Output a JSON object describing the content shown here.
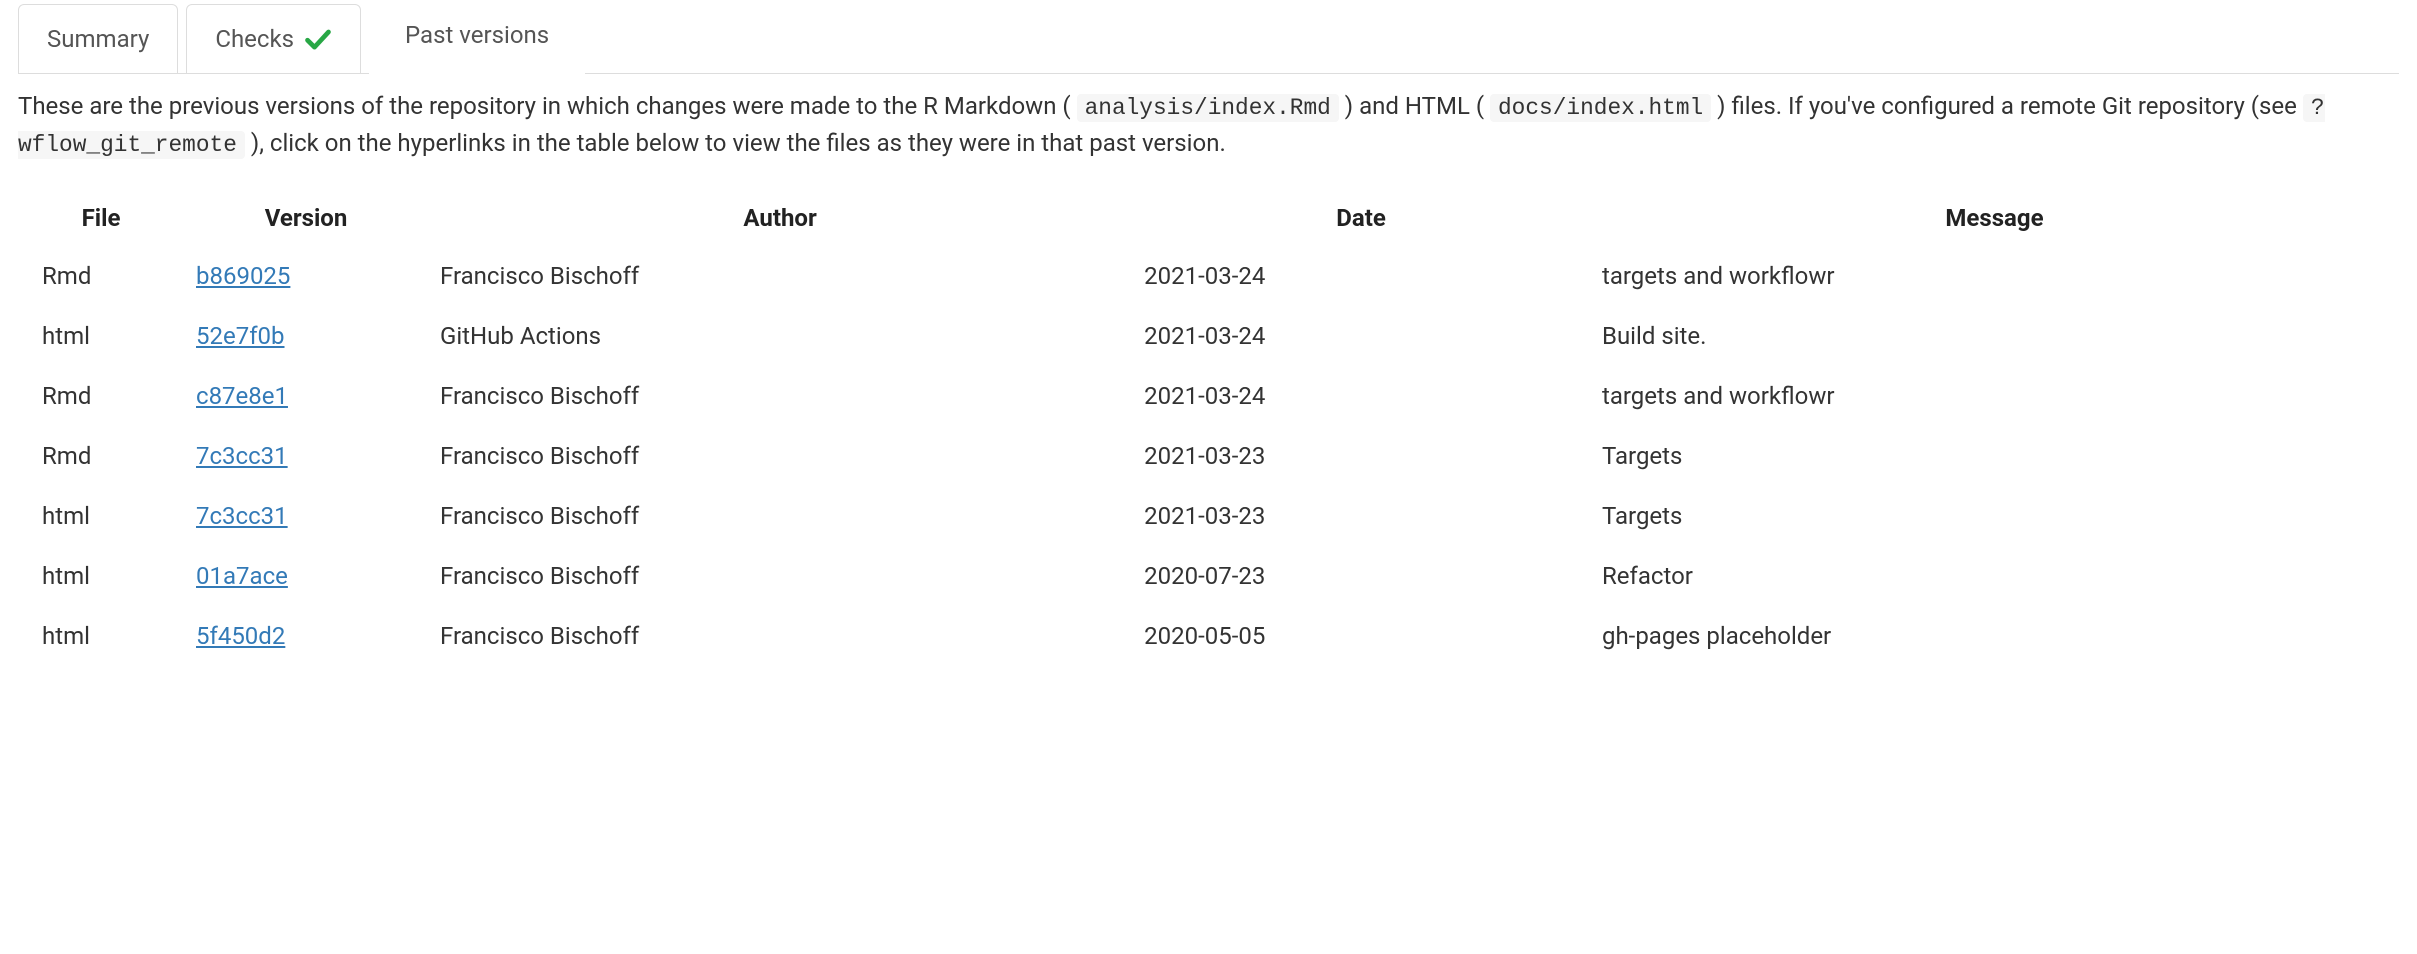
{
  "tabs": {
    "summary": {
      "label": "Summary"
    },
    "checks": {
      "label": "Checks"
    },
    "past_versions": {
      "label": "Past versions"
    }
  },
  "intro": {
    "part1": "These are the previous versions of the repository in which changes were made to the R Markdown (",
    "code1": "analysis/index.Rmd",
    "part2": ") and HTML (",
    "code2": "docs/index.html",
    "part3": ") files. If you've configured a remote Git repository (see ",
    "code3": "?wflow_git_remote",
    "part4": "), click on the hyperlinks in the table below to view the files as they were in that past version."
  },
  "table": {
    "headers": {
      "file": "File",
      "version": "Version",
      "author": "Author",
      "date": "Date",
      "message": "Message"
    },
    "rows": [
      {
        "file": "Rmd",
        "version": "b869025",
        "author": "Francisco Bischoff",
        "date": "2021-03-24",
        "message": "targets and workflowr"
      },
      {
        "file": "html",
        "version": "52e7f0b",
        "author": "GitHub Actions",
        "date": "2021-03-24",
        "message": "Build site."
      },
      {
        "file": "Rmd",
        "version": "c87e8e1",
        "author": "Francisco Bischoff",
        "date": "2021-03-24",
        "message": "targets and workflowr"
      },
      {
        "file": "Rmd",
        "version": "7c3cc31",
        "author": "Francisco Bischoff",
        "date": "2021-03-23",
        "message": "Targets"
      },
      {
        "file": "html",
        "version": "7c3cc31",
        "author": "Francisco Bischoff",
        "date": "2021-03-23",
        "message": "Targets"
      },
      {
        "file": "html",
        "version": "01a7ace",
        "author": "Francisco Bischoff",
        "date": "2020-07-23",
        "message": "Refactor"
      },
      {
        "file": "html",
        "version": "5f450d2",
        "author": "Francisco Bischoff",
        "date": "2020-05-05",
        "message": "gh-pages placeholder"
      }
    ]
  }
}
